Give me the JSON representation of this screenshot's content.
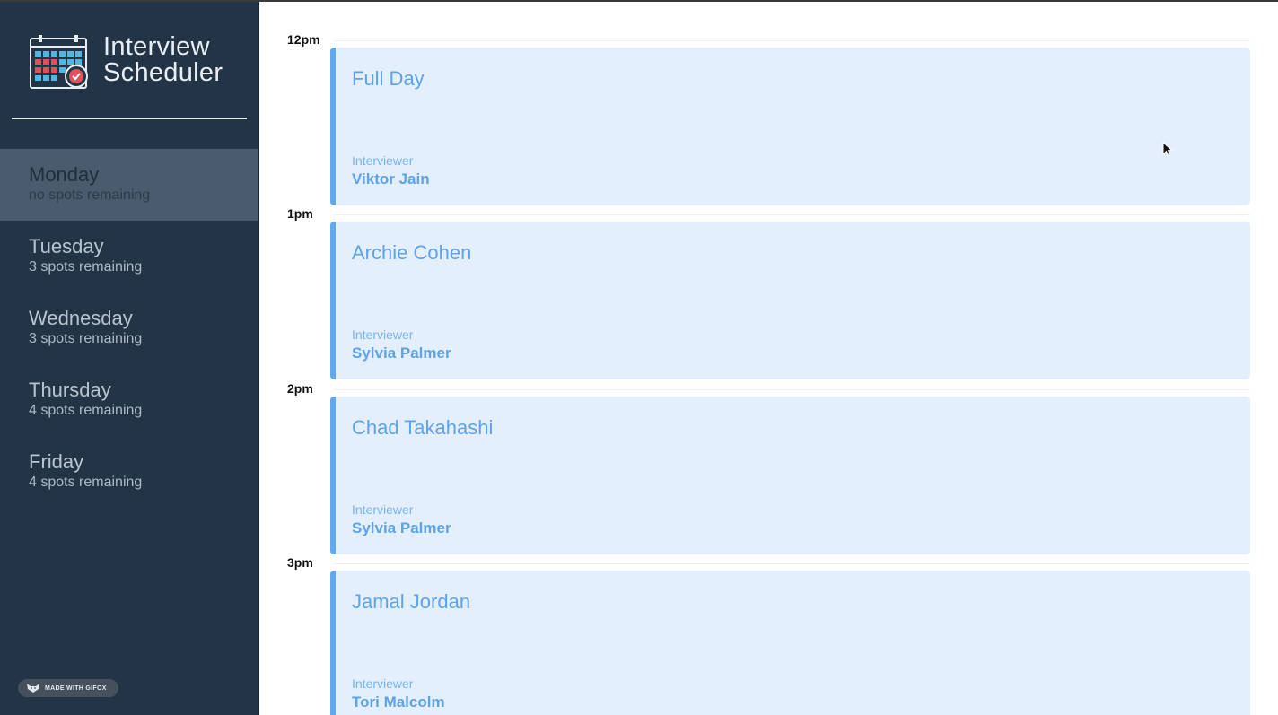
{
  "app": {
    "title_line1": "Interview",
    "title_line2": "Scheduler",
    "icon": "calendar-check-icon"
  },
  "sidebar": {
    "selected": "Monday",
    "days": [
      {
        "name": "Monday",
        "spots": "no spots remaining"
      },
      {
        "name": "Tuesday",
        "spots": "3 spots remaining"
      },
      {
        "name": "Wednesday",
        "spots": "3 spots remaining"
      },
      {
        "name": "Thursday",
        "spots": "4 spots remaining"
      },
      {
        "name": "Friday",
        "spots": "4 spots remaining"
      }
    ]
  },
  "schedule": {
    "appointments": [
      {
        "time": "12pm",
        "student": "Full Day",
        "interviewer_label": "Interviewer",
        "interviewer": "Viktor Jain"
      },
      {
        "time": "1pm",
        "student": "Archie Cohen",
        "interviewer_label": "Interviewer",
        "interviewer": "Sylvia Palmer"
      },
      {
        "time": "2pm",
        "student": "Chad Takahashi",
        "interviewer_label": "Interviewer",
        "interviewer": "Sylvia Palmer"
      },
      {
        "time": "3pm",
        "student": "Jamal Jordan",
        "interviewer_label": "Interviewer",
        "interviewer": "Tori Malcolm"
      }
    ]
  },
  "watermark": {
    "label": "MADE WITH GIFOX",
    "icon": "fox-icon"
  },
  "colors": {
    "sidebar_bg": "#243447",
    "selected_day_bg": "#4a5b6d",
    "card_bg": "#e3effc",
    "card_accent": "#62a8ef",
    "card_text": "#5ea3e9"
  }
}
